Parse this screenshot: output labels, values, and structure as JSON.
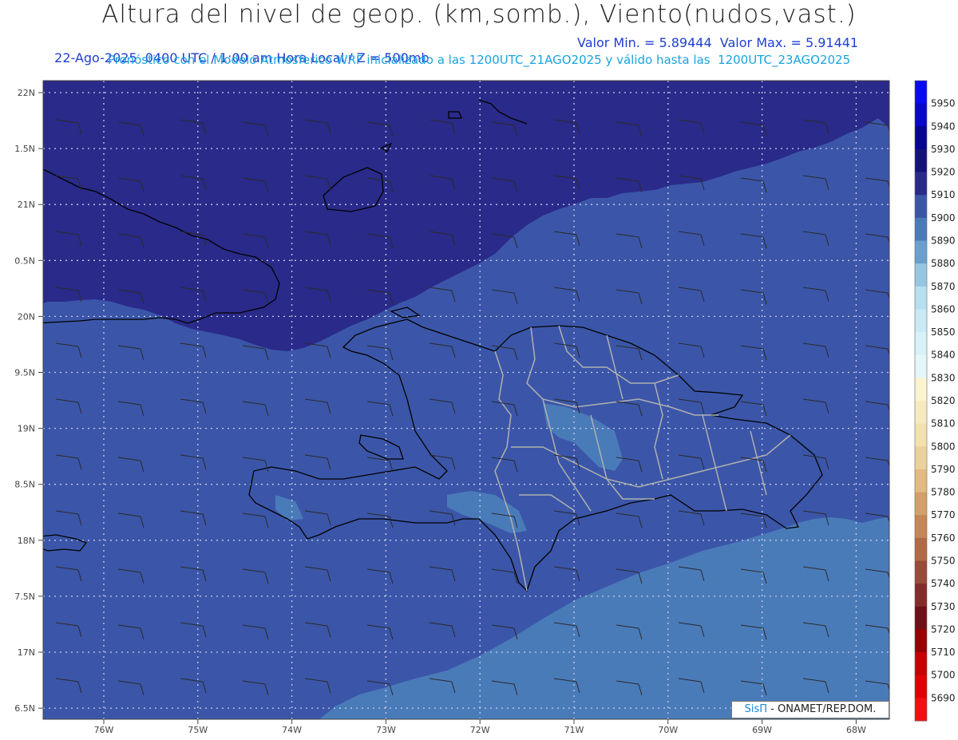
{
  "title": "Altura del nivel de geop. (km,somb.), Viento(nudos,vast.)",
  "subtitle_left": "22-Ago-2025  0400 UTC / 1:00 am Hora Local / Z = 500mb",
  "subtitle_right": "Valor Min. = 5.89444  Valor Max. = 5.91441",
  "subtitle2": "Pronóstico con el Modelo Atmosferico WRF inicializado a las 1200UTC_21AGO2025 y válido hasta las  1200UTC_23AGO2025",
  "credit": {
    "logo": "SisΠ",
    "text": " - ONAMET/REP.DOM."
  },
  "lat_labels": [
    "22N",
    "1.5N",
    "21N",
    "0.5N",
    "20N",
    "9.5N",
    "19N",
    "8.5N",
    "18N",
    "7.5N",
    "17N",
    "6.5N"
  ],
  "lon_labels": [
    "76W",
    "75W",
    "74W",
    "73W",
    "72W",
    "71W",
    "70W",
    "69W",
    "68W"
  ],
  "colorbar": {
    "levels": [
      "5950",
      "5940",
      "5930",
      "5920",
      "5910",
      "5900",
      "5890",
      "5880",
      "5870",
      "5860",
      "5850",
      "5840",
      "5830",
      "5820",
      "5810",
      "5800",
      "5790",
      "5780",
      "5770",
      "5760",
      "5750",
      "5740",
      "5730",
      "5720",
      "5710",
      "5700",
      "5690"
    ],
    "colors": [
      "#0a0af0",
      "#0808c8",
      "#060690",
      "#14137a",
      "#2a2a8a",
      "#3b56a8",
      "#4a7bb9",
      "#6aa0cf",
      "#97c6e0",
      "#b7dff0",
      "#c9eaf4",
      "#d7f1f7",
      "#e5f7fa",
      "#fbf4d0",
      "#f6eac0",
      "#f2e0ad",
      "#ebd19a",
      "#e1bb80",
      "#d3a06a",
      "#c68656",
      "#b26a45",
      "#9a4a38",
      "#842c2c",
      "#6e1018",
      "#9a0000",
      "#c80000",
      "#e00000",
      "#f21010"
    ],
    "field_colors": {
      "z5910": "#2a2a8a",
      "z5900": "#3b56a8",
      "z5890": "#4a7bb9"
    }
  }
}
